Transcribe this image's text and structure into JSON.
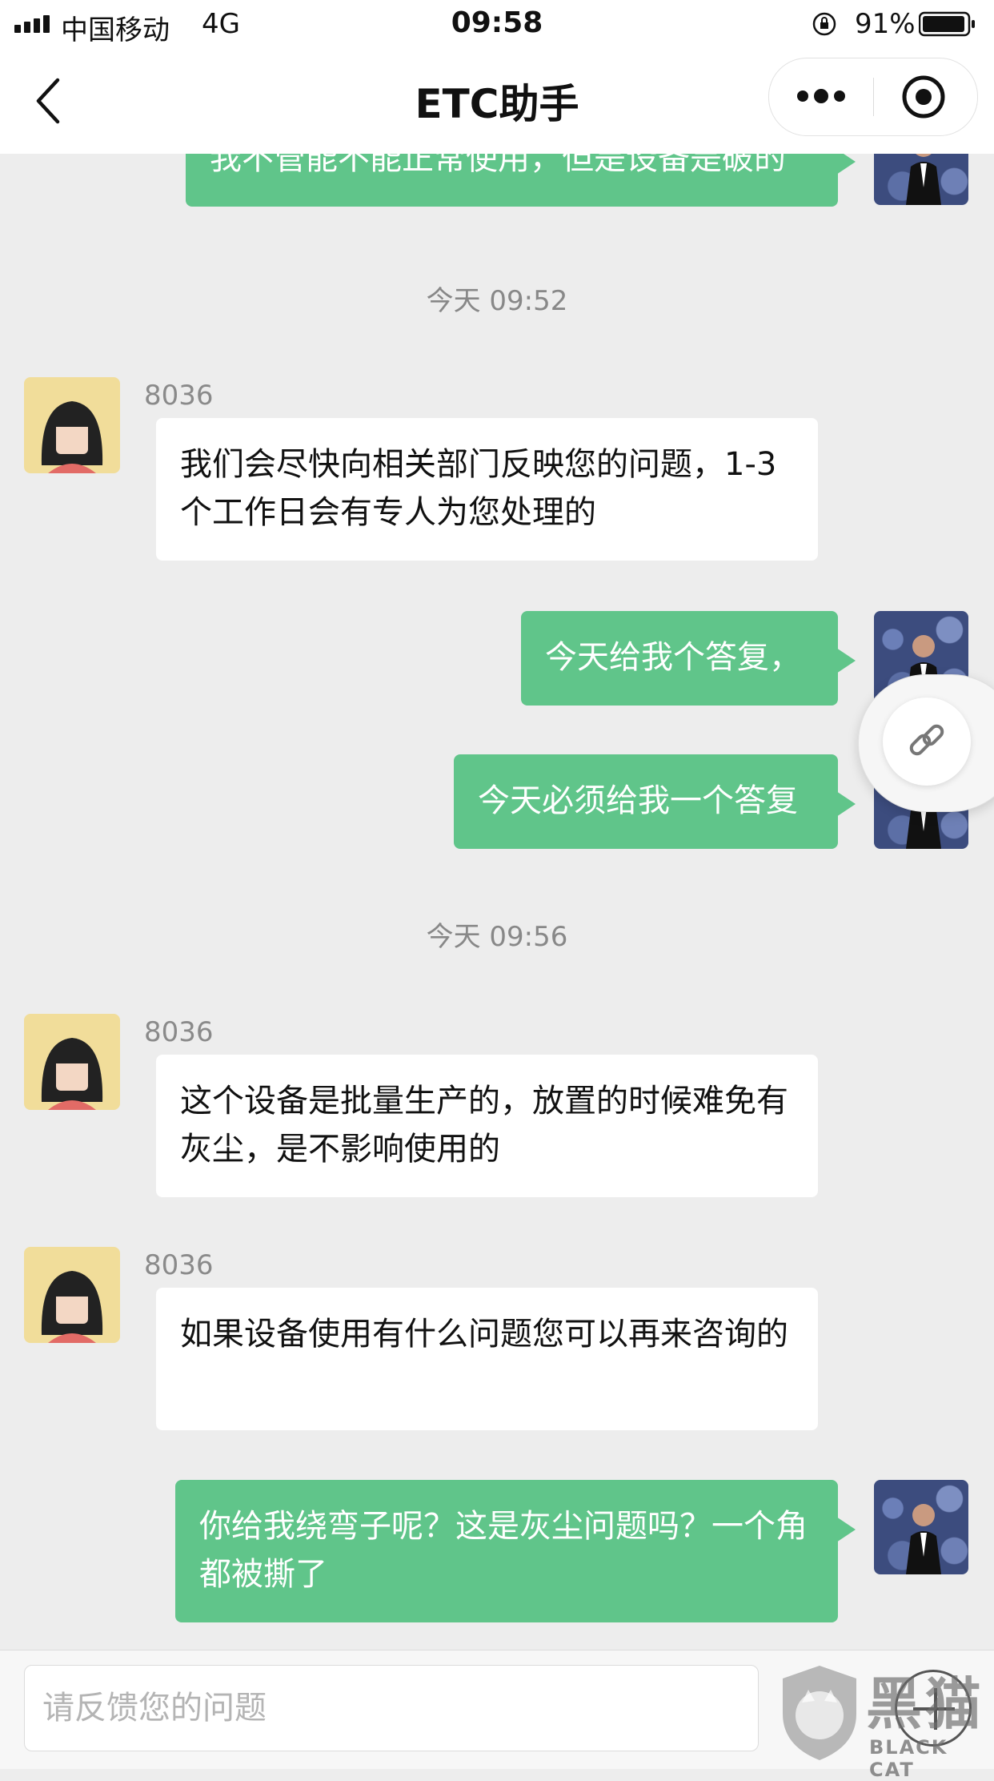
{
  "status_bar": {
    "carrier": "中国移动",
    "network": "4G",
    "time": "09:58",
    "battery": "91%"
  },
  "nav": {
    "title": "ETC助手"
  },
  "messages": [
    {
      "type": "out",
      "text": "我不管能不能正常使用，但是设备是破的"
    },
    {
      "type": "time",
      "text": "今天 09:52"
    },
    {
      "type": "in",
      "sender": "8036",
      "text": "我们会尽快向相关部门反映您的问题，1-3个工作日会有专人为您处理的"
    },
    {
      "type": "out",
      "text": "今天给我个答复，"
    },
    {
      "type": "out",
      "text": "今天必须给我一个答复"
    },
    {
      "type": "time",
      "text": "今天 09:56"
    },
    {
      "type": "in",
      "sender": "8036",
      "text": "这个设备是批量生产的，放置的时候难免有灰尘，是不影响使用的"
    },
    {
      "type": "in",
      "sender": "8036",
      "text": "如果设备使用有什么问题您可以再来咨询的"
    },
    {
      "type": "out",
      "text": "你给我绕弯子呢？这是灰尘问题吗？一个角都被撕了"
    }
  ],
  "input": {
    "placeholder": "请反馈您的问题"
  },
  "watermark": {
    "cn": "黑猫",
    "en": "BLACK CAT"
  },
  "colors": {
    "bubble_out": "#60c58a",
    "background": "#ededed"
  }
}
